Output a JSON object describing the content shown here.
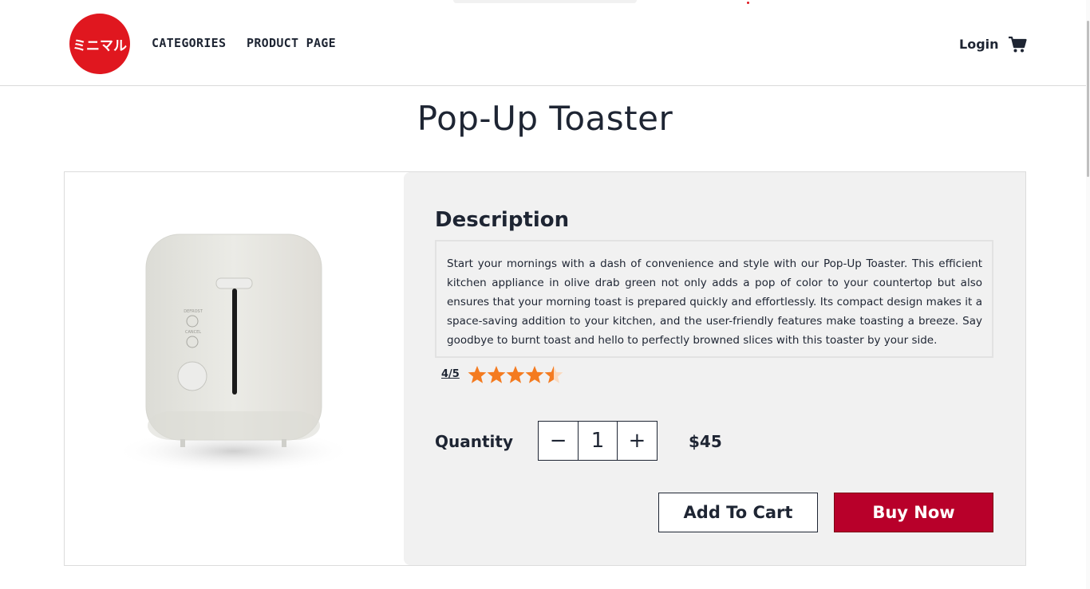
{
  "header": {
    "logo_text": "ミニマル",
    "nav": [
      {
        "label": "CATEGORIES"
      },
      {
        "label": "PRODUCT PAGE"
      }
    ],
    "login_label": "Login",
    "cart_icon": "shopping-cart-icon"
  },
  "product": {
    "title": "Pop-Up Toaster",
    "image_icon": "toaster-image",
    "toaster_labels": {
      "defrost": "DEFROST",
      "cancel": "CANCEL"
    },
    "description_heading": "Description",
    "description": "Start your mornings with a dash of convenience and style with our Pop-Up Toaster. This efficient kitchen appliance in olive drab green not only adds a pop of color to your countertop but also ensures that your morning toast is prepared quickly and effortlessly. Its compact design makes it a space-saving addition to your kitchen, and the user-friendly features make toasting a breeze. Say goodbye to burnt toast and hello to perfectly browned slices with this toaster by your side.",
    "rating_text": "4/5",
    "rating_value": 4.5,
    "rating_max": 5,
    "quantity_label": "Quantity",
    "quantity_value": "1",
    "decrement_label": "−",
    "increment_label": "+",
    "price": "$45",
    "add_to_cart_label": "Add To Cart",
    "buy_now_label": "Buy Now"
  },
  "colors": {
    "brand_red": "#e0171f",
    "buy_button": "#b8002a",
    "star": "#f47b20",
    "text": "#1e2533",
    "panel_bg": "#f1f1f1"
  }
}
